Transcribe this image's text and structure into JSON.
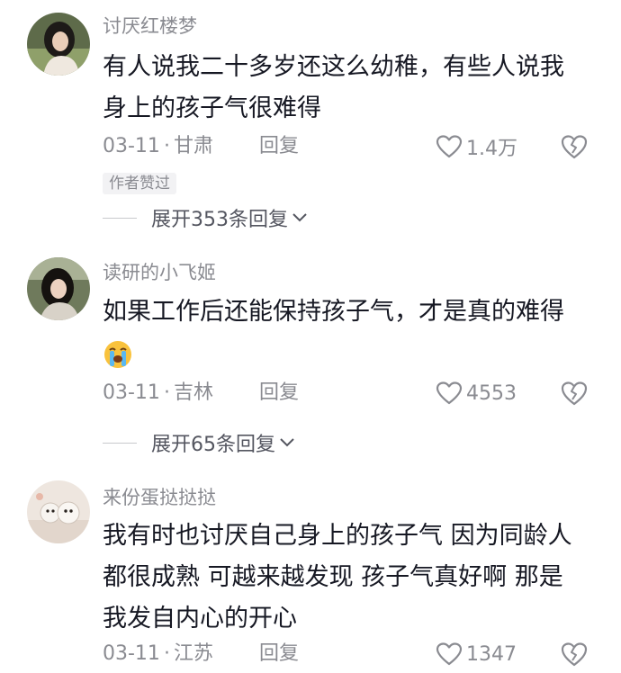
{
  "comments": [
    {
      "username": "讨厌红楼梦",
      "lines": [
        "有人说我二十多岁还这么幼稚，有些人说我",
        "身上的孩子气很难得"
      ],
      "date": "03-11",
      "location": "甘肃",
      "reply_label": "回复",
      "likes": "1.4万",
      "tag": "作者赞过",
      "expand_label": "展开353条回复"
    },
    {
      "username": "读研的小飞姬",
      "lines": [
        "如果工作后还能保持孩子气，才是真的难得"
      ],
      "emoji": "loudly-crying-face-emoji",
      "date": "03-11",
      "location": "吉林",
      "reply_label": "回复",
      "likes": "4553",
      "expand_label": "展开65条回复"
    },
    {
      "username": "来份蛋挞挞挞",
      "lines": [
        "我有时也讨厌自己身上的孩子气 因为同龄人",
        "都很成熟 可越来越发现 孩子气真好啊 那是",
        "我发自内心的开心"
      ],
      "date": "03-11",
      "location": "江苏",
      "reply_label": "回复",
      "likes": "1347"
    }
  ],
  "icons": {
    "like": "heart-outline-icon",
    "dislike": "broken-heart-icon",
    "expand": "chevron-down-icon"
  },
  "colors": {
    "text": "#161823",
    "secondary": "#8a8b91",
    "tag_bg": "#f2f2f4"
  }
}
